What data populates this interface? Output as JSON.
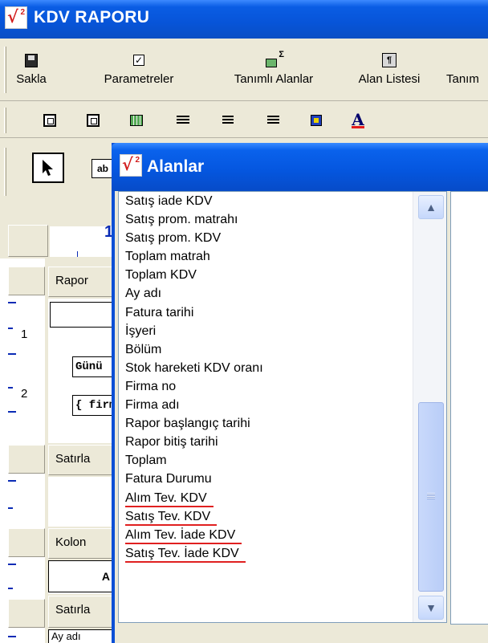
{
  "main_window": {
    "title": "KDV RAPORU",
    "logo": "logo-icon"
  },
  "toolbar1": {
    "buttons": [
      {
        "label": "Sakla",
        "icon": "save-icon"
      },
      {
        "label": "Parametreler",
        "icon": "checkbox-icon"
      },
      {
        "label": "Tanımlı Alanlar",
        "icon": "defined-fields-icon"
      },
      {
        "label": "Alan Listesi",
        "icon": "field-list-icon"
      },
      {
        "label": "Tanım",
        "icon": ""
      }
    ]
  },
  "toolbar2": {
    "icons": [
      "align-grid-icon",
      "align-objects-icon",
      "grid-icon",
      "align-left-icon",
      "align-center-icon",
      "align-right-icon",
      "color-icon",
      "font-color-icon"
    ],
    "font_glyph": "A"
  },
  "toolbar3": {
    "label_button": "ab"
  },
  "ruler": {
    "number": "1"
  },
  "designer": {
    "left_ruler_numbers": [
      "1",
      "2"
    ],
    "bands": [
      "Rapor",
      "Satırla",
      "Kolon",
      "Satırla"
    ],
    "fields": [
      "Günü",
      "{ firm",
      "Ay adı"
    ],
    "text_a": "A"
  },
  "dialog": {
    "title": "Alanlar",
    "fields": [
      "Satış iade KDV",
      "Satış prom. matrahı",
      "Satış prom. KDV",
      "Toplam matrah",
      "Toplam KDV",
      "Ay adı",
      "Fatura tarihi",
      "İşyeri",
      "Bölüm",
      "Stok hareketi KDV oranı",
      "Firma no",
      "Firma adı",
      "Rapor başlangıç tarihi",
      "Rapor bitiş tarihi",
      "Toplam",
      "Fatura Durumu",
      "Alım Tev. KDV",
      "Satış Tev. KDV",
      "Alım Tev. İade KDV",
      "Satış Tev. İade KDV"
    ],
    "highlighted_fields": [
      "Alım Tev. KDV",
      "Satış Tev. KDV",
      "Alım Tev. İade KDV",
      "Satış Tev. İade KDV"
    ],
    "highlight_color": "#e02020",
    "scroll_up": "▲",
    "scroll_down": "▼"
  }
}
